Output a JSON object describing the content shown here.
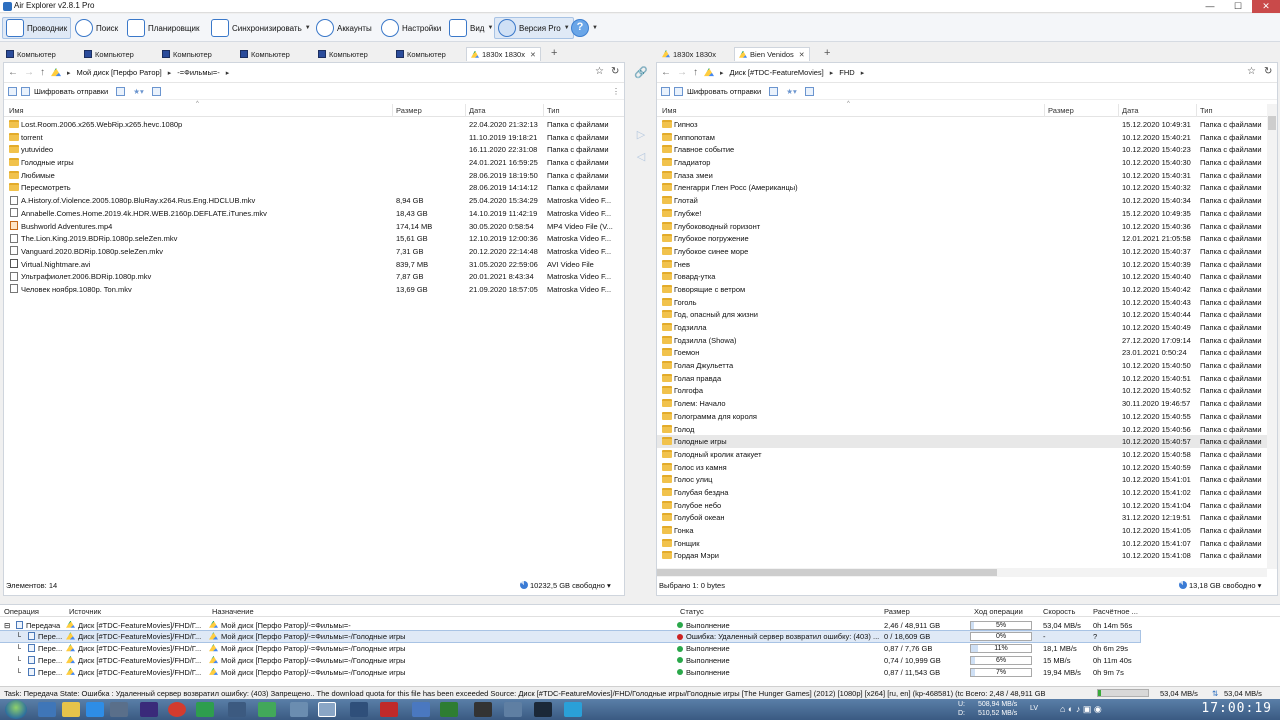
{
  "window": {
    "title": "Air Explorer v2.8.1 Pro",
    "min": "—",
    "max": "☐",
    "close": "✕"
  },
  "toolbar": {
    "explorer": "Проводник",
    "search": "Поиск",
    "scheduler": "Планировщик",
    "sync": "Синхронизировать",
    "accounts": "Аккаунты",
    "settings": "Настройки",
    "view": "Вид",
    "pro": "Версия Pro",
    "help": "?"
  },
  "left": {
    "tabs": [
      "Компьютер",
      "Компьютер",
      "Компьютер",
      "Компьютер",
      "Компьютер",
      "Компьютер",
      "1830x 1830x"
    ],
    "breadcrumb": [
      "Мой диск [Перфо Ратор]",
      "-=Фильмы=-"
    ],
    "encrypt": "Шифровать отправки",
    "columns": {
      "name": "Имя",
      "size": "Размер",
      "date": "Дата",
      "type": "Тип"
    },
    "rows": [
      {
        "icon": "folder",
        "name": "Lost.Room.2006.x265.WebRip.x265.hevc.1080p",
        "size": "",
        "date": "22.04.2020 21:32:13",
        "type": "Папка с файлами"
      },
      {
        "icon": "folder",
        "name": "torrent",
        "size": "",
        "date": "11.10.2019 19:18:21",
        "type": "Папка с файлами"
      },
      {
        "icon": "folder",
        "name": "yutuvideo",
        "size": "",
        "date": "16.11.2020 22:31:08",
        "type": "Папка с файлами"
      },
      {
        "icon": "folder",
        "name": "Голодные игры",
        "size": "",
        "date": "24.01.2021 16:59:25",
        "type": "Папка с файлами"
      },
      {
        "icon": "folder",
        "name": "Любимые",
        "size": "",
        "date": "28.06.2019 18:19:50",
        "type": "Папка с файлами"
      },
      {
        "icon": "folder",
        "name": "Пересмотреть",
        "size": "",
        "date": "28.06.2019 14:14:12",
        "type": "Папка с файлами"
      },
      {
        "icon": "file",
        "name": "A.History.of.Violence.2005.1080p.BluRay.x264.Rus.Eng.HDCLUB.mkv",
        "size": "8,94 GB",
        "date": "25.04.2020 15:34:29",
        "type": "Matroska Video F..."
      },
      {
        "icon": "file",
        "name": "Annabelle.Comes.Home.2019.4k.HDR.WEB.2160p.DEFLATE.iTunes.mkv",
        "size": "18,43 GB",
        "date": "14.10.2019 11:42:19",
        "type": "Matroska Video F..."
      },
      {
        "icon": "mp4",
        "name": "Bushworld Adventures.mp4",
        "size": "174,14 MB",
        "date": "30.05.2020 0:58:54",
        "type": "MP4 Video File (V..."
      },
      {
        "icon": "file",
        "name": "The.Lion.King.2019.BDRip.1080p.seleZen.mkv",
        "size": "15,61 GB",
        "date": "12.10.2019 12:00:36",
        "type": "Matroska Video F..."
      },
      {
        "icon": "file",
        "name": "Vanguard.2020.BDRip.1080p.seleZen.mkv",
        "size": "7,31 GB",
        "date": "20.12.2020 22:14:48",
        "type": "Matroska Video F..."
      },
      {
        "icon": "avi",
        "name": "Virtual.Nightmare.avi",
        "size": "839,7 MB",
        "date": "31.05.2020 22:59:06",
        "type": "AVI Video File"
      },
      {
        "icon": "file",
        "name": "Ультрафиолет.2006.BDRip.1080p.mkv",
        "size": "7,87 GB",
        "date": "20.01.2021 8:43:34",
        "type": "Matroska Video F..."
      },
      {
        "icon": "file",
        "name": "Человек ноября.1080p. Ton.mkv",
        "size": "13,69 GB",
        "date": "21.09.2020 18:57:05",
        "type": "Matroska Video F..."
      }
    ],
    "status_count": "Элементов: 14",
    "free_space": "10232,5 GB свободно"
  },
  "right": {
    "tabs": [
      "1830x 1830x",
      "Bien Venidos"
    ],
    "breadcrumb": [
      "Диск [#TDC-FeatureMovies]",
      "FHD"
    ],
    "encrypt": "Шифровать отправки",
    "columns": {
      "name": "Имя",
      "size": "Размер",
      "date": "Дата",
      "type": "Тип"
    },
    "type_text": "Папка с файлами",
    "rows": [
      {
        "name": "Гипноз",
        "date": "15.12.2020 10:49:31"
      },
      {
        "name": "Гиппопотам",
        "date": "10.12.2020 15:40:21"
      },
      {
        "name": "Главное событие",
        "date": "10.12.2020 15:40:23"
      },
      {
        "name": "Гладиатор",
        "date": "10.12.2020 15:40:30"
      },
      {
        "name": "Глаза змеи",
        "date": "10.12.2020 15:40:31"
      },
      {
        "name": "Гленгарри Глен Росс (Американцы)",
        "date": "10.12.2020 15:40:32"
      },
      {
        "name": "Глотай",
        "date": "10.12.2020 15:40:34"
      },
      {
        "name": "Глубже!",
        "date": "15.12.2020 10:49:35"
      },
      {
        "name": "Глубоководный горизонт",
        "date": "10.12.2020 15:40:36"
      },
      {
        "name": "Глубокое погружение",
        "date": "12.01.2021 21:05:58"
      },
      {
        "name": "Глубокое синее море",
        "date": "10.12.2020 15:40:37"
      },
      {
        "name": "Гнев",
        "date": "10.12.2020 15:40:39"
      },
      {
        "name": "Говард-утка",
        "date": "10.12.2020 15:40:40"
      },
      {
        "name": "Говорящие с ветром",
        "date": "10.12.2020 15:40:42"
      },
      {
        "name": "Гоголь",
        "date": "10.12.2020 15:40:43"
      },
      {
        "name": "Год, опасный для жизни",
        "date": "10.12.2020 15:40:44"
      },
      {
        "name": "Годзилла",
        "date": "10.12.2020 15:40:49"
      },
      {
        "name": "Годзилла (Showa)",
        "date": "27.12.2020 17:09:14"
      },
      {
        "name": "Гоемон",
        "date": "23.01.2021 0:50:24"
      },
      {
        "name": "Голая Джульетта",
        "date": "10.12.2020 15:40:50"
      },
      {
        "name": "Голая правда",
        "date": "10.12.2020 15:40:51"
      },
      {
        "name": "Голгофа",
        "date": "10.12.2020 15:40:52"
      },
      {
        "name": "Голем: Начало",
        "date": "30.11.2020 19:46:57"
      },
      {
        "name": "Голограмма для короля",
        "date": "10.12.2020 15:40:55"
      },
      {
        "name": "Голод",
        "date": "10.12.2020 15:40:56"
      },
      {
        "name": "Голодные игры",
        "date": "10.12.2020 15:40:57",
        "hl": true
      },
      {
        "name": "Голодный кролик атакует",
        "date": "10.12.2020 15:40:58"
      },
      {
        "name": "Голос из камня",
        "date": "10.12.2020 15:40:59"
      },
      {
        "name": "Голос улиц",
        "date": "10.12.2020 15:41:01"
      },
      {
        "name": "Голубая бездна",
        "date": "10.12.2020 15:41:02"
      },
      {
        "name": "Голубое небо",
        "date": "10.12.2020 15:41:04"
      },
      {
        "name": "Голубой океан",
        "date": "31.12.2020 12:19:51"
      },
      {
        "name": "Гонка",
        "date": "10.12.2020 15:41:05"
      },
      {
        "name": "Гонщик",
        "date": "10.12.2020 15:41:07"
      },
      {
        "name": "Гордая Мэри",
        "date": "10.12.2020 15:41:08"
      }
    ],
    "status_selected": "Выбрано 1: 0 bytes",
    "free_space": "13,18 GB свободно"
  },
  "operations": {
    "columns": {
      "op": "Операция",
      "source": "Источник",
      "dest": "Назначение",
      "status": "Статус",
      "size": "Размер",
      "progress": "Ход операции",
      "speed": "Скорость",
      "remaining": "Расчётное ..."
    },
    "rows": [
      {
        "op": "Передача",
        "source": "Диск [#TDC-FeatureMovies]/FHD/Г...",
        "dest": "Мой диск [Перфо Ратор]/-=Фильмы=-",
        "status": "Выполнение",
        "dot": "#2aa84a",
        "size": "2,46 / 48,911 GB",
        "progress": 5,
        "progress_text": "5%",
        "speed": "53,04 MB/s",
        "remaining": "0h 14m 56s"
      },
      {
        "op": "Пере...",
        "source": "Диск [#TDC-FeatureMovies]/FHD/Г...",
        "dest": "Мой диск [Перфо Ратор]/-=Фильмы=-/Голодные игры",
        "status": "Ошибка: Удаленный сервер возвратил ошибку: (403) ...",
        "dot": "#cc2222",
        "size": "0 / 18,609 GB",
        "progress": 0,
        "progress_text": "0%",
        "speed": "-",
        "remaining": "?",
        "sel": true
      },
      {
        "op": "Пере...",
        "source": "Диск [#TDC-FeatureMovies]/FHD/Г...",
        "dest": "Мой диск [Перфо Ратор]/-=Фильмы=-/Голодные игры",
        "status": "Выполнение",
        "dot": "#2aa84a",
        "size": "0,87 / 7,76 GB",
        "progress": 11,
        "progress_text": "11%",
        "speed": "18,1 MB/s",
        "remaining": "0h 6m 29s"
      },
      {
        "op": "Пере...",
        "source": "Диск [#TDC-FeatureMovies]/FHD/Г...",
        "dest": "Мой диск [Перфо Ратор]/-=Фильмы=-/Голодные игры",
        "status": "Выполнение",
        "dot": "#2aa84a",
        "size": "0,74 / 10,999 GB",
        "progress": 6,
        "progress_text": "6%",
        "speed": "15 MB/s",
        "remaining": "0h 11m 40s"
      },
      {
        "op": "Пере...",
        "source": "Диск [#TDC-FeatureMovies]/FHD/Г...",
        "dest": "Мой диск [Перфо Ратор]/-=Фильмы=-/Голодные игры",
        "status": "Выполнение",
        "dot": "#2aa84a",
        "size": "0,87 / 11,543 GB",
        "progress": 7,
        "progress_text": "7%",
        "speed": "19,94 MB/s",
        "remaining": "0h 9m 7s"
      }
    ]
  },
  "statusbar": {
    "task": "Task: Передача State: Ошибка : Удаленный сервер возвратил ошибку: (403) Запрещено.. The download quota for this file has been exceeded Source: Диск [#TDC-FeatureMovies]/FHD/Голодные игры/Голодные игры [The Hunger Games] (2012) [1080p] [x264] [ru, en] (kp-468581) (tc Всего: 2,48 / 48,911 GB",
    "speed1": "53,04 MB/s",
    "speed2": "53,04 MB/s"
  },
  "taskbar": {
    "drive_u": "U:",
    "drive_d": "D:",
    "disk_free_1": "508,94 MB/s",
    "disk_free_2": "510,52 MB/s",
    "lang": "LV",
    "clock": "17:00:19"
  },
  "colors": {
    "accent": "#3a78c9",
    "error": "#cc2222",
    "ok": "#2aa84a",
    "folder": "#f1c24c"
  }
}
